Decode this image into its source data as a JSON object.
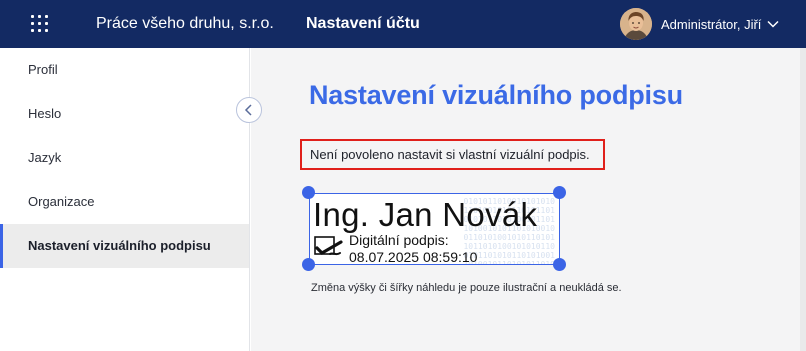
{
  "header": {
    "apps_icon": "apps-grid-icon",
    "org_name": "Práce všeho druhu, s.r.o.",
    "section_title": "Nastavení účtu",
    "user_name": "Administrátor, Jiří",
    "user_menu_icon": "chevron-down-icon",
    "colors": {
      "bar": "#132a63"
    }
  },
  "sidebar": {
    "items": [
      {
        "label": "Profil"
      },
      {
        "label": "Heslo"
      },
      {
        "label": "Jazyk"
      },
      {
        "label": "Organizace"
      },
      {
        "label": "Nastavení vizuálního podpisu",
        "active": true
      }
    ],
    "collapse_icon": "chevron-left-icon"
  },
  "main": {
    "title": "Nastavení vizuálního podpisu",
    "alert_text": "Není povoleno nastavit si vlastní vizuální podpis.",
    "signature": {
      "name": "Ing. Jan Novák",
      "label": "Digitální podpis:",
      "datetime": "08.07.2025 08:59:10",
      "icon": "signature-checkmark-icon"
    },
    "note": "Změna výšky či šířky náhledu je pouze ilustrační a neukládá se.",
    "colors": {
      "accent": "#3b6ae6",
      "alert_border": "#e0201b"
    }
  }
}
